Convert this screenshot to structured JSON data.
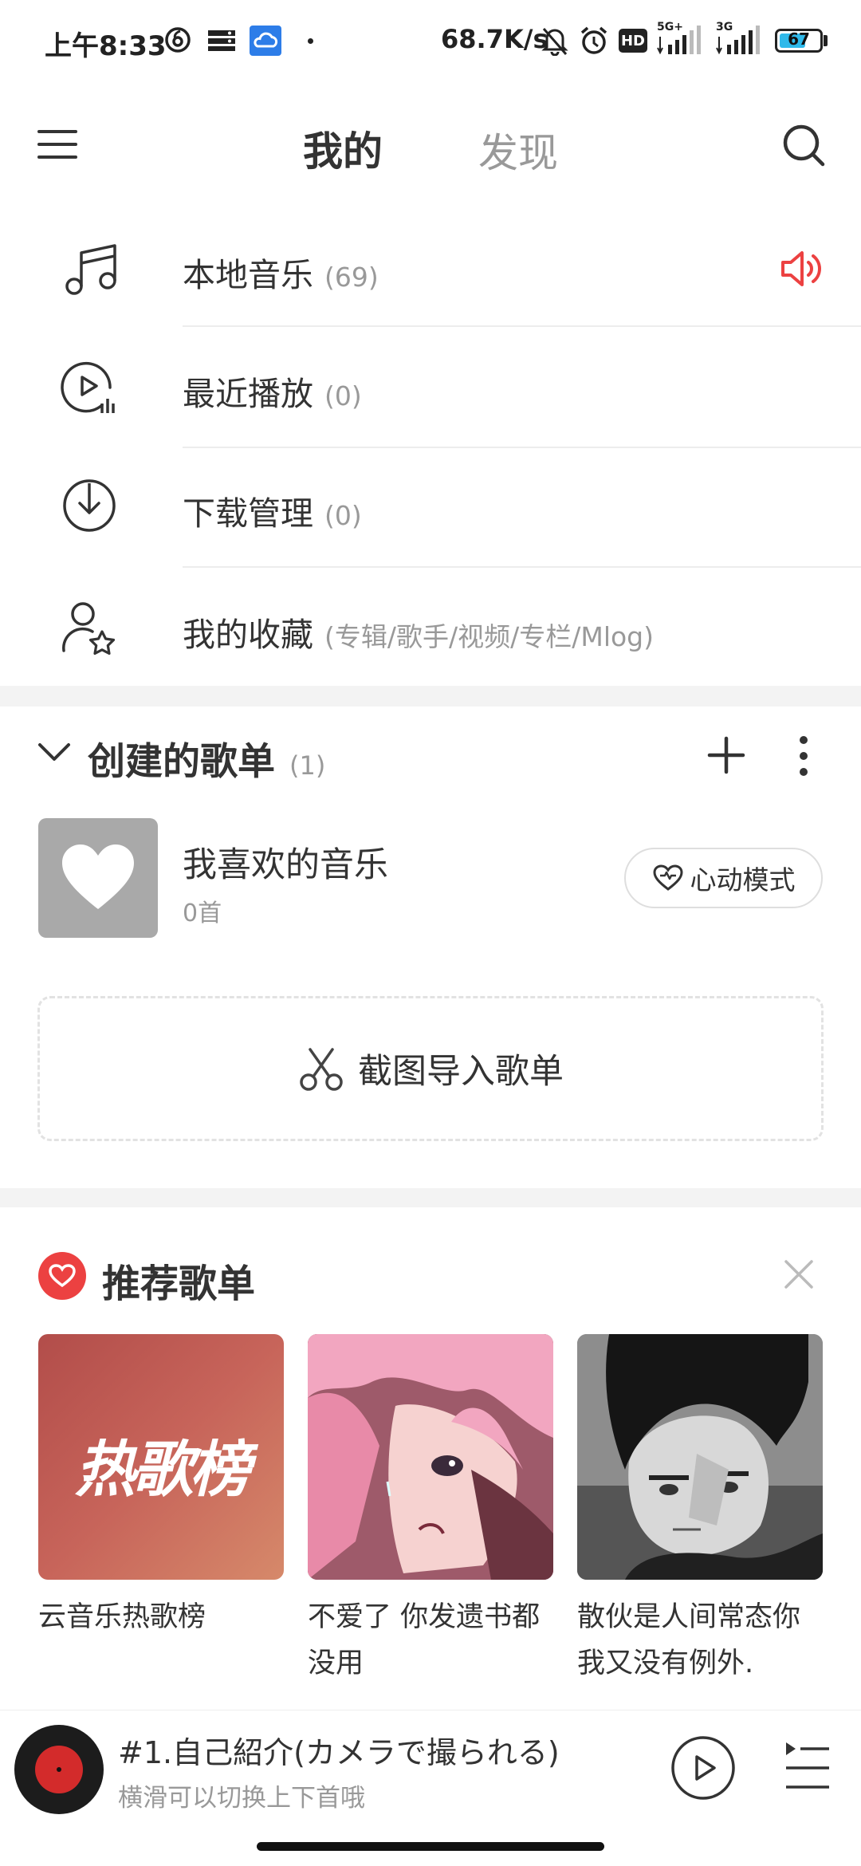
{
  "status_bar": {
    "time": "上午8:33",
    "net_speed": "68.7K/s",
    "hd_label": "HD",
    "sig1_label": "5G+",
    "sig2_label": "3G",
    "battery_level": "67",
    "battery_fraction": 0.67,
    "battery_color": "#2fb9ea"
  },
  "header": {
    "tab_mine": "我的",
    "tab_discover": "发现"
  },
  "menu": [
    {
      "label": "本地音乐",
      "count": "(69)",
      "icon": "music-note-icon"
    },
    {
      "label": "最近播放",
      "count": "(0)",
      "icon": "recent-play-icon"
    },
    {
      "label": "下载管理",
      "count": "(0)",
      "icon": "download-icon"
    },
    {
      "label": "我的收藏",
      "count": "(专辑/歌手/视频/专栏/Mlog)",
      "icon": "user-star-icon"
    }
  ],
  "created_playlists": {
    "title": "创建的歌单",
    "count": "(1)",
    "items": [
      {
        "name": "我喜欢的音乐",
        "songs": "0首",
        "heart_mode_label": "心动模式"
      }
    ],
    "import_label": "截图导入歌单"
  },
  "recommended": {
    "title": "推荐歌单",
    "accent_color": "#ec4141",
    "items": [
      {
        "name": "云音乐热歌榜",
        "cover_text": "热歌榜"
      },
      {
        "name": "不爱了 你发遗书都没用"
      },
      {
        "name": "散伙是人间常态你我又没有例外."
      }
    ]
  },
  "player": {
    "title": "#1.自己紹介(カメラで撮られる)",
    "subtitle": "横滑可以切换上下首哦"
  }
}
